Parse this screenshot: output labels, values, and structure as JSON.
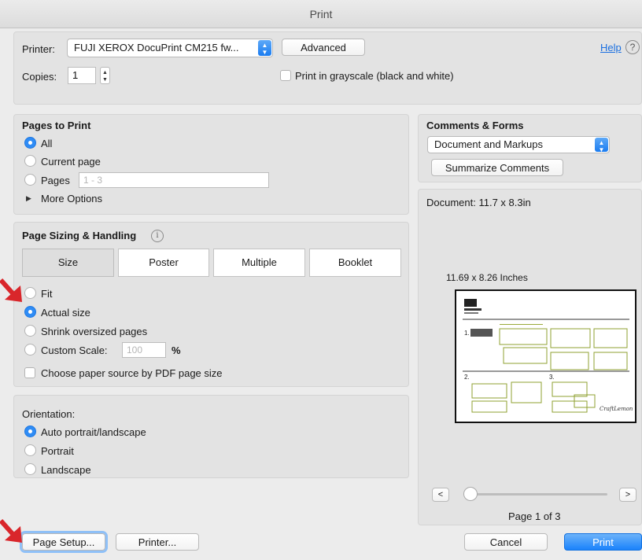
{
  "window": {
    "title": "Print"
  },
  "printer_row": {
    "printer_label": "Printer:",
    "printer_value": "FUJI XEROX DocuPrint CM215 fw...",
    "advanced_label": "Advanced",
    "help_label": "Help",
    "copies_label": "Copies:",
    "copies_value": "1",
    "grayscale_label": "Print in grayscale (black and white)"
  },
  "pages_to_print": {
    "title": "Pages to Print",
    "all_label": "All",
    "current_label": "Current page",
    "pages_label": "Pages",
    "pages_placeholder": "1 - 3",
    "more_options_label": "More Options"
  },
  "sizing": {
    "title": "Page Sizing & Handling",
    "tabs": [
      {
        "label": "Size",
        "selected": true
      },
      {
        "label": "Poster",
        "selected": false
      },
      {
        "label": "Multiple",
        "selected": false
      },
      {
        "label": "Booklet",
        "selected": false
      }
    ],
    "fit_label": "Fit",
    "actual_label": "Actual size",
    "shrink_label": "Shrink oversized pages",
    "custom_label": "Custom Scale:",
    "custom_value": "100",
    "percent_label": "%",
    "paper_source_label": "Choose paper source by PDF page size"
  },
  "orientation": {
    "title": "Orientation:",
    "auto_label": "Auto portrait/landscape",
    "portrait_label": "Portrait",
    "landscape_label": "Landscape"
  },
  "comments": {
    "title": "Comments & Forms",
    "selected": "Document and Markups",
    "summarize_label": "Summarize Comments"
  },
  "preview": {
    "document_label": "Document: 11.7 x 8.3in",
    "size_label": "11.69 x 8.26 Inches",
    "prev_label": "<",
    "next_label": ">",
    "page_label": "Page 1 of 3",
    "slider_position": 0
  },
  "footer": {
    "page_setup_label": "Page Setup...",
    "printer_label": "Printer...",
    "cancel_label": "Cancel",
    "print_label": "Print"
  },
  "colors": {
    "accent": "#2f8cf5",
    "primary_button": "#1a82fb",
    "annotation_arrow": "#d9262b"
  }
}
